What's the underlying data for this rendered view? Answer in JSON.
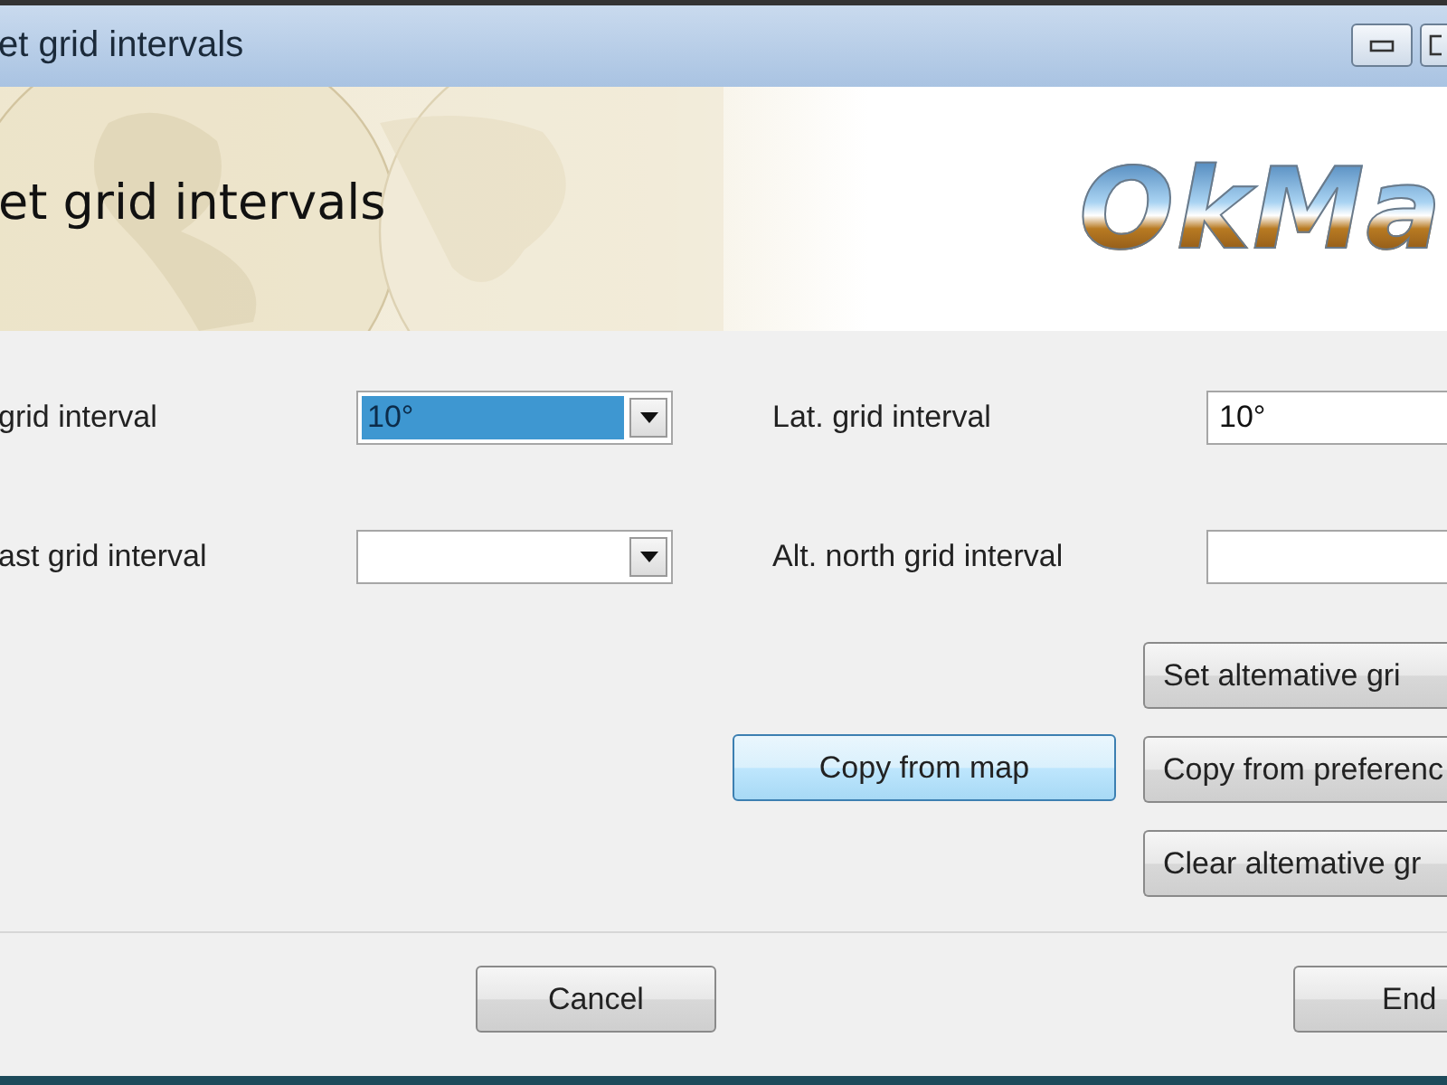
{
  "window": {
    "title": "et grid intervals"
  },
  "banner": {
    "heading": "et grid intervals",
    "logo": "OkMa"
  },
  "fields": [
    {
      "kind": "combo",
      "label": "grid interval",
      "value": "10°",
      "highlighted": true
    },
    {
      "kind": "text",
      "label": "Lat. grid interval",
      "value": "10°",
      "highlighted": false
    },
    {
      "kind": "combo",
      "label": "ast grid interval",
      "highlighted": false
    },
    {
      "kind": "text",
      "label": "Alt. north grid interval",
      "highlighted": false
    }
  ],
  "side_buttons": [
    {
      "label": "Set altemative gri",
      "focused": false
    },
    {
      "label": "Copy from preferenc",
      "focused": false
    },
    {
      "label": "Clear altemative gr",
      "focused": false
    }
  ],
  "copy_button": {
    "label": "Copy from map",
    "focused": true
  },
  "footer_buttons": [
    {
      "label": "Cancel"
    },
    {
      "label": "End"
    }
  ]
}
